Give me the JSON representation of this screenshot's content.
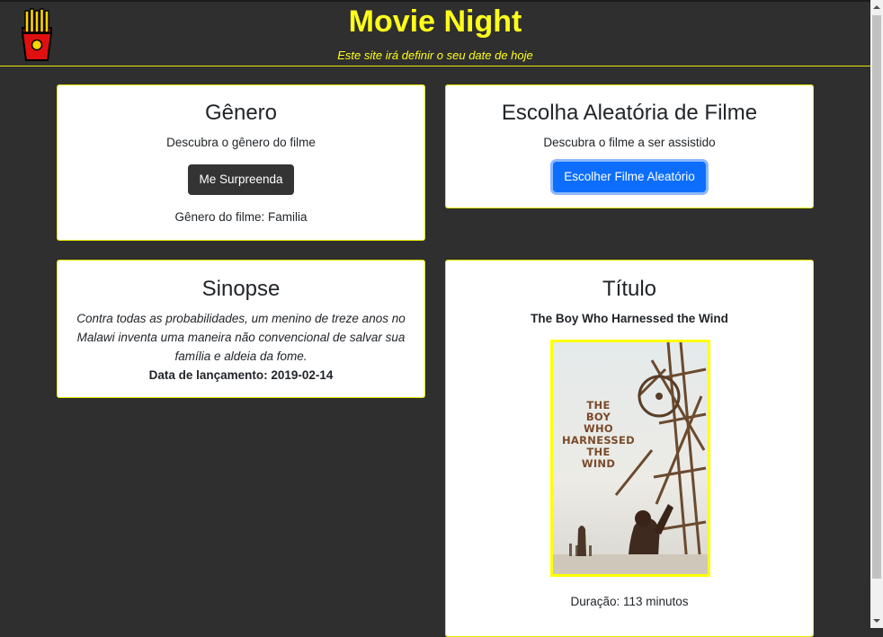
{
  "header": {
    "title": "Movie Night",
    "subtitle": "Este site irá definir o seu date de hoje",
    "logo_icon": "fries-icon"
  },
  "genre_card": {
    "title": "Gênero",
    "description": "Descubra o gênero do filme",
    "button_label": "Me Surpreenda",
    "result": "Gênero do filme: Familia"
  },
  "random_card": {
    "title": "Escolha Aleatória de Filme",
    "description": "Descubra o filme a ser assistido",
    "button_label": "Escolher Filme Aleatório"
  },
  "synopsis_card": {
    "title": "Sinopse",
    "text": "Contra todas as probabilidades, um menino de treze anos no Malawi inventa uma maneira não convencional de salvar sua família e aldeia da fome.",
    "release": "Data de lançamento: 2019-02-14"
  },
  "title_card": {
    "title": "Título",
    "movie_name": "The Boy Who Harnessed the Wind",
    "poster_text": [
      "THE",
      "BOY",
      "WHO",
      "HARNESSED",
      "THE",
      "WIND"
    ],
    "duration": "Duração: 113 minutos"
  },
  "colors": {
    "background": "#2f2f2f",
    "accent_yellow": "#ffff1a",
    "primary_blue": "#0d6efd",
    "dark_button": "#343434"
  }
}
